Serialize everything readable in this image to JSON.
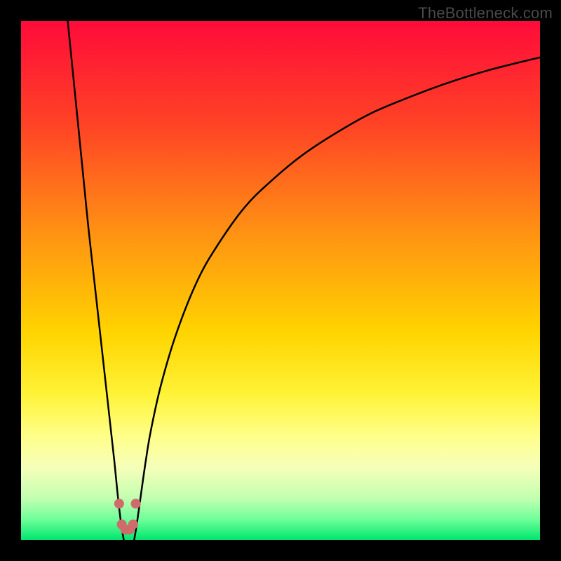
{
  "watermark": "TheBottleneck.com",
  "chart_data": {
    "type": "line",
    "title": "",
    "xlabel": "",
    "ylabel": "",
    "xlim": [
      0,
      100
    ],
    "ylim": [
      0,
      100
    ],
    "grid": false,
    "legend": false,
    "background_gradient": {
      "stops": [
        {
          "pos": 0.0,
          "color": "#ff0b3a"
        },
        {
          "pos": 0.2,
          "color": "#ff4325"
        },
        {
          "pos": 0.4,
          "color": "#ff8f14"
        },
        {
          "pos": 0.6,
          "color": "#ffd400"
        },
        {
          "pos": 0.72,
          "color": "#fff338"
        },
        {
          "pos": 0.8,
          "color": "#ffff8a"
        },
        {
          "pos": 0.86,
          "color": "#f6ffba"
        },
        {
          "pos": 0.92,
          "color": "#c2ffb0"
        },
        {
          "pos": 0.96,
          "color": "#6fff9a"
        },
        {
          "pos": 1.0,
          "color": "#00e66f"
        }
      ]
    },
    "series": [
      {
        "name": "left-branch",
        "x": [
          9,
          10,
          11,
          12,
          13,
          14,
          15,
          16,
          17,
          18,
          18.7,
          19.3,
          19.8
        ],
        "y": [
          100,
          90,
          80,
          70,
          60,
          51,
          42,
          33,
          24,
          15,
          8,
          3,
          0
        ]
      },
      {
        "name": "right-branch",
        "x": [
          21.8,
          22.3,
          23,
          24,
          25,
          27,
          30,
          34,
          38,
          43,
          48,
          54,
          60,
          67,
          74,
          82,
          90,
          100
        ],
        "y": [
          0,
          3,
          8,
          15,
          21,
          30,
          40,
          50,
          57,
          64,
          69,
          74,
          78,
          82,
          85,
          88,
          90.5,
          93
        ]
      }
    ],
    "dip_markers": {
      "name": "dip-dots",
      "color": "#cf6b6b",
      "points": [
        {
          "x": 18.9,
          "y": 7.0
        },
        {
          "x": 19.4,
          "y": 3.0
        },
        {
          "x": 20.1,
          "y": 2.0
        },
        {
          "x": 20.9,
          "y": 2.0
        },
        {
          "x": 21.6,
          "y": 3.0
        },
        {
          "x": 22.1,
          "y": 7.0
        }
      ]
    }
  }
}
